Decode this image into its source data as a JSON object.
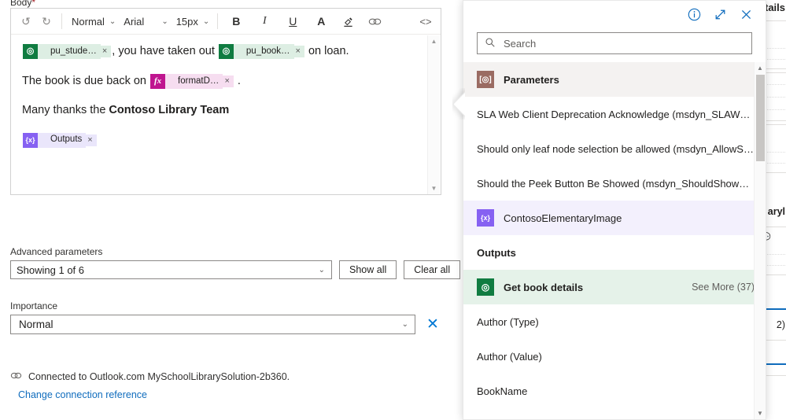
{
  "editor": {
    "field_label": "Body",
    "required_marker": "*",
    "toolbar": {
      "undo": "↺",
      "redo": "↻",
      "style_value": "Normal",
      "font_value": "Arial",
      "size_value": "15px",
      "bold": "B",
      "italic": "I",
      "underline": "U",
      "font_color": "A",
      "highlight": "▲",
      "link": "link-icon",
      "code": "<>",
      "chevron": "⌄"
    },
    "content": {
      "line1": {
        "chip1": {
          "text": "pu_stude…",
          "icon": "◎",
          "close": "×",
          "kind": "green"
        },
        "mid_text": ", you have taken out ",
        "chip2": {
          "text": "pu_book…",
          "icon": "◎",
          "close": "×",
          "kind": "green"
        },
        "end_text": " on loan."
      },
      "line2": {
        "pre_text": "The book is due back on ",
        "chip": {
          "text": "formatD…",
          "icon": "fx",
          "close": "×",
          "kind": "pink"
        },
        "post_text": " ."
      },
      "line3": {
        "normal_text": "Many thanks the ",
        "bold_text": "Contoso Library Team"
      },
      "line4": {
        "chip": {
          "text": "Outputs",
          "icon": "{x}",
          "close": "×",
          "kind": "purple"
        }
      }
    },
    "scroll_up": "▲",
    "scroll_down": "▼"
  },
  "advanced": {
    "label": "Advanced parameters",
    "combo_value": "Showing 1 of 6",
    "show_all": "Show all",
    "clear_all": "Clear all"
  },
  "importance": {
    "label": "Importance",
    "value": "Normal",
    "clear": "✕"
  },
  "connection": {
    "icon": "link-chain-icon",
    "text": "Connected to Outlook.com MySchoolLibrarySolution-2b360.",
    "link": "Change connection reference"
  },
  "flyout": {
    "header": {
      "info": "ⓘ",
      "expand": "⤢",
      "close": "✕"
    },
    "search": {
      "placeholder": "Search",
      "icon": "search-icon"
    },
    "items": [
      {
        "label": "Parameters",
        "icon": "[◎]",
        "icon_kind": "brown",
        "shade": "gray",
        "type": "group"
      },
      {
        "label": "SLA Web Client Deprecation Acknowledge (msdyn_SLAWebClien…",
        "icon": null,
        "shade": "none",
        "type": "item"
      },
      {
        "label": "Should only leaf node selection be allowed (msdyn_AllowSelectL…",
        "icon": null,
        "shade": "none",
        "type": "item"
      },
      {
        "label": "Should the Peek Button Be Showed (msdyn_ShouldShowPeekBut…",
        "icon": null,
        "shade": "none",
        "type": "item"
      },
      {
        "label": "ContosoElementaryImage",
        "icon": "{x}",
        "icon_kind": "purple",
        "shade": "purple",
        "type": "item"
      },
      {
        "label": "Outputs",
        "icon": null,
        "shade": "none",
        "type": "group"
      },
      {
        "label": "Get book details",
        "icon": "◎",
        "icon_kind": "green",
        "shade": "green",
        "type": "item",
        "more": "See More (37)"
      },
      {
        "label": "Author (Type)",
        "icon": null,
        "shade": "none",
        "type": "item"
      },
      {
        "label": "Author (Value)",
        "icon": null,
        "shade": "none",
        "type": "item"
      },
      {
        "label": "BookName",
        "icon": null,
        "shade": "none",
        "type": "item"
      }
    ],
    "scroll_up": "▲",
    "scroll_down": "▼"
  },
  "background": {
    "title": "tails",
    "partial_text_1": "aryl",
    "partial_text_2": "2)"
  }
}
